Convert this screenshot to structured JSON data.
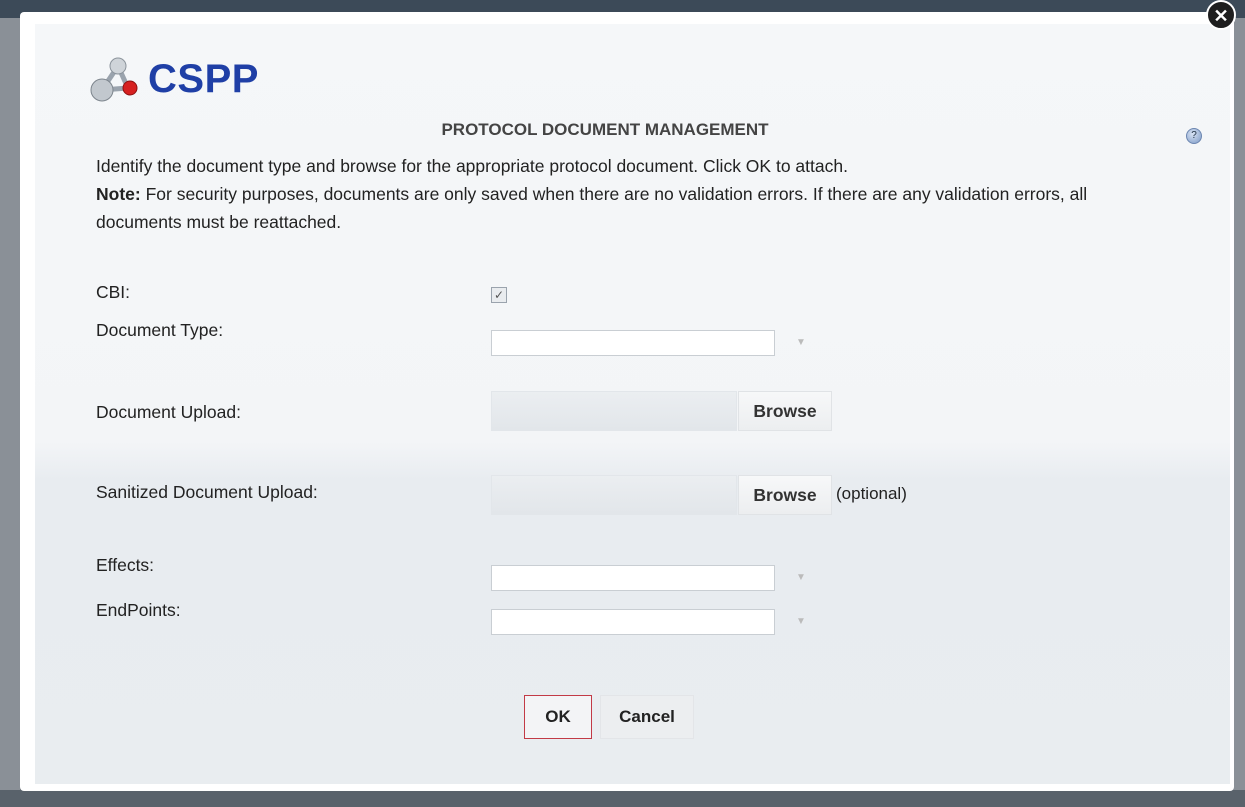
{
  "app": {
    "logo_text": "CSPP",
    "title": "PROTOCOL DOCUMENT MANAGEMENT"
  },
  "instructions": {
    "line1": "Identify the document type and browse for the appropriate protocol document. Click OK to attach.",
    "note_label": "Note:",
    "note_text": " For security purposes, documents are only saved when there are no validation errors. If there are any validation errors, all documents must be reattached."
  },
  "form": {
    "cbi_label": "CBI:",
    "cbi_checked": true,
    "cbi_check_glyph": "✓",
    "document_type_label": "Document Type:",
    "document_type_value": "",
    "document_upload_label": "Document Upload:",
    "browse_label": "Browse",
    "sanitized_upload_label": "Sanitized Document Upload:",
    "optional_text": "(optional)",
    "effects_label": "Effects:",
    "effects_value": "",
    "endpoints_label": "EndPoints:",
    "endpoints_value": ""
  },
  "buttons": {
    "ok": "OK",
    "cancel": "Cancel",
    "close_glyph": "✕"
  },
  "icons": {
    "logo": "molecule-icon",
    "help": "help-icon",
    "close": "close-icon",
    "dropdown": "chevron-down-icon"
  },
  "colors": {
    "brand": "#1f3fa6",
    "ok_border": "#c23a46"
  }
}
